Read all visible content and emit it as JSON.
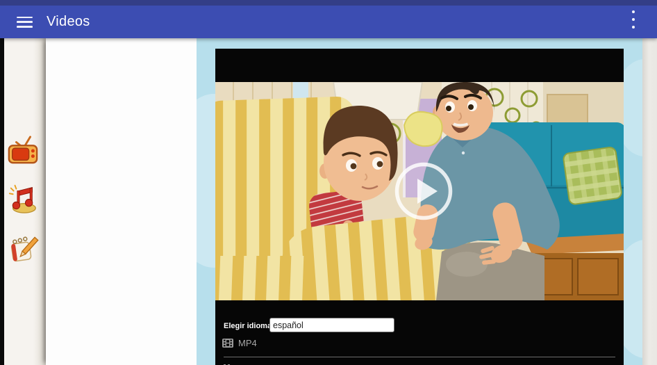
{
  "app_bar": {
    "title": "Videos",
    "menu_icon": "hamburger-menu-icon",
    "overflow_icon": "kebab-menu-icon"
  },
  "sidebar": {
    "items": [
      {
        "icon": "tv-icon"
      },
      {
        "icon": "music-notes-icon"
      },
      {
        "icon": "notepad-pencil-icon"
      }
    ]
  },
  "video_panel": {
    "play_icon": "play-icon",
    "thumbnail_description": "animated scene: boy on yellow striped armchair with man kneeling beside teal sofa",
    "language_label": "Elegir idioma",
    "language_value": "español",
    "formats": [
      {
        "icon": "film-icon",
        "label": "MP4"
      }
    ]
  },
  "colors": {
    "status_bar": "#333e87",
    "app_bar": "#3c4db2",
    "content_background": "#b7dfec",
    "video_background": "#060606",
    "sidebar_background": "#f6f3ef"
  }
}
